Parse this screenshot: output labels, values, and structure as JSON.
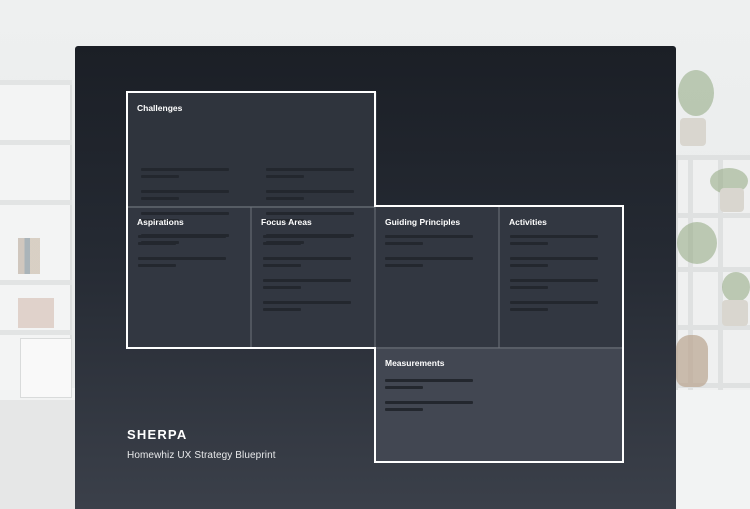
{
  "blueprint": {
    "brand": "SHERPA",
    "subtitle": "Homewhiz UX Strategy Blueprint",
    "sections": {
      "challenges": "Challenges",
      "aspirations": "Aspirations",
      "focus_areas": "Focus Areas",
      "guiding_principles": "Guiding Principles",
      "activities": "Activities",
      "measurements": "Measurements"
    }
  }
}
